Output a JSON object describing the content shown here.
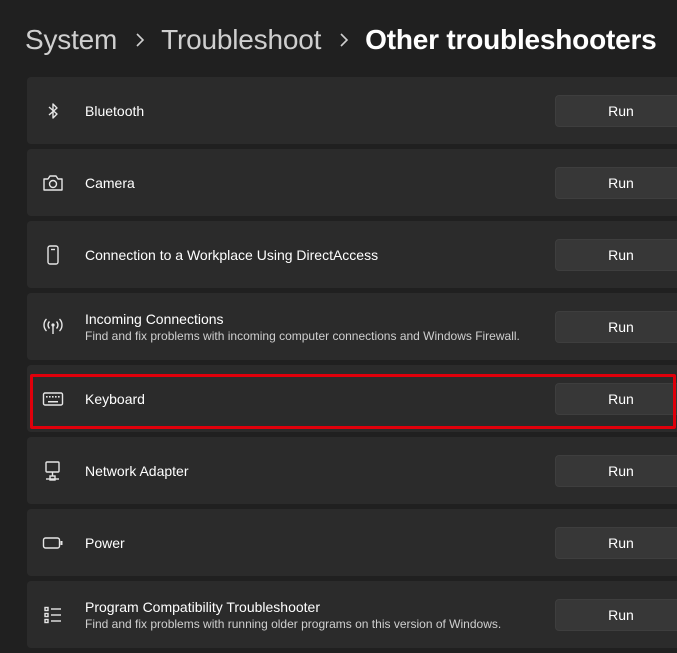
{
  "breadcrumb": {
    "items": [
      "System",
      "Troubleshoot",
      "Other troubleshooters"
    ]
  },
  "troubleshooters": [
    {
      "icon": "bluetooth-icon",
      "title": "Bluetooth",
      "description": "",
      "button": "Run"
    },
    {
      "icon": "camera-icon",
      "title": "Camera",
      "description": "",
      "button": "Run"
    },
    {
      "icon": "phone-device-icon",
      "title": "Connection to a Workplace Using DirectAccess",
      "description": "",
      "button": "Run"
    },
    {
      "icon": "antenna-signal-icon",
      "title": "Incoming Connections",
      "description": "Find and fix problems with incoming computer connections and Windows Firewall.",
      "button": "Run"
    },
    {
      "icon": "keyboard-icon",
      "title": "Keyboard",
      "description": "",
      "button": "Run",
      "highlighted": true
    },
    {
      "icon": "network-adapter-icon",
      "title": "Network Adapter",
      "description": "",
      "button": "Run"
    },
    {
      "icon": "battery-icon",
      "title": "Power",
      "description": "",
      "button": "Run"
    },
    {
      "icon": "list-icon",
      "title": "Program Compatibility Troubleshooter",
      "description": "Find and fix problems with running older programs on this version of Windows.",
      "button": "Run"
    }
  ],
  "colors": {
    "background": "#202020",
    "card": "#2b2b2b",
    "button": "#373737",
    "highlight_border": "#e0000b"
  }
}
